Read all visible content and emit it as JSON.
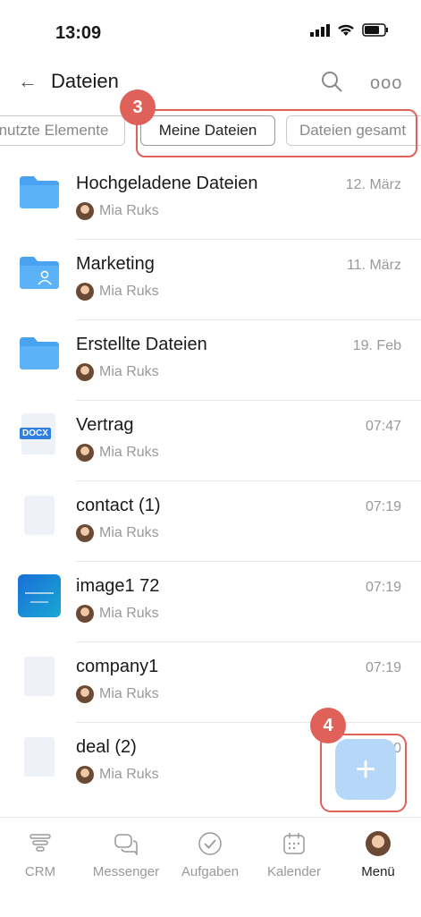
{
  "status": {
    "time": "13:09"
  },
  "header": {
    "title": "Dateien"
  },
  "tabs": [
    {
      "label": "nutzte Elemente"
    },
    {
      "label": "Meine Dateien"
    },
    {
      "label": "Dateien gesamt"
    }
  ],
  "badges": {
    "b3": "3",
    "b4": "4"
  },
  "files": [
    {
      "name": "Hochgeladene Dateien",
      "date": "12. März",
      "owner": "Mia Ruks",
      "icon": "folder-icon"
    },
    {
      "name": "Marketing",
      "date": "11. März",
      "owner": "Mia Ruks",
      "icon": "shared-folder-icon"
    },
    {
      "name": "Erstellte Dateien",
      "date": "19. Feb",
      "owner": "Mia Ruks",
      "icon": "folder-icon"
    },
    {
      "name": "Vertrag",
      "date": "07:47",
      "owner": "Mia Ruks",
      "icon": "docx-icon",
      "icon_label": "DOCX"
    },
    {
      "name": "contact (1)",
      "date": "07:19",
      "owner": "Mia Ruks",
      "icon": "file-icon"
    },
    {
      "name": "image1 72",
      "date": "07:19",
      "owner": "Mia Ruks",
      "icon": "image-thumbnail"
    },
    {
      "name": "company1",
      "date": "07:19",
      "owner": "Mia Ruks",
      "icon": "file-icon"
    },
    {
      "name": "deal (2)",
      "date": "07:20",
      "owner": "Mia Ruks",
      "icon": "file-icon"
    }
  ],
  "fab": {
    "label": "+"
  },
  "bottom_nav": [
    {
      "label": "CRM",
      "icon": "crm-funnel-icon"
    },
    {
      "label": "Messenger",
      "icon": "chat-icon"
    },
    {
      "label": "Aufgaben",
      "icon": "check-circle-icon"
    },
    {
      "label": "Kalender",
      "icon": "calendar-icon"
    },
    {
      "label": "Menü",
      "icon": "avatar",
      "active": true
    }
  ],
  "colors": {
    "accent": "#e0605a",
    "folder": "#4aa3f0",
    "fab": "#b6d7f7"
  }
}
